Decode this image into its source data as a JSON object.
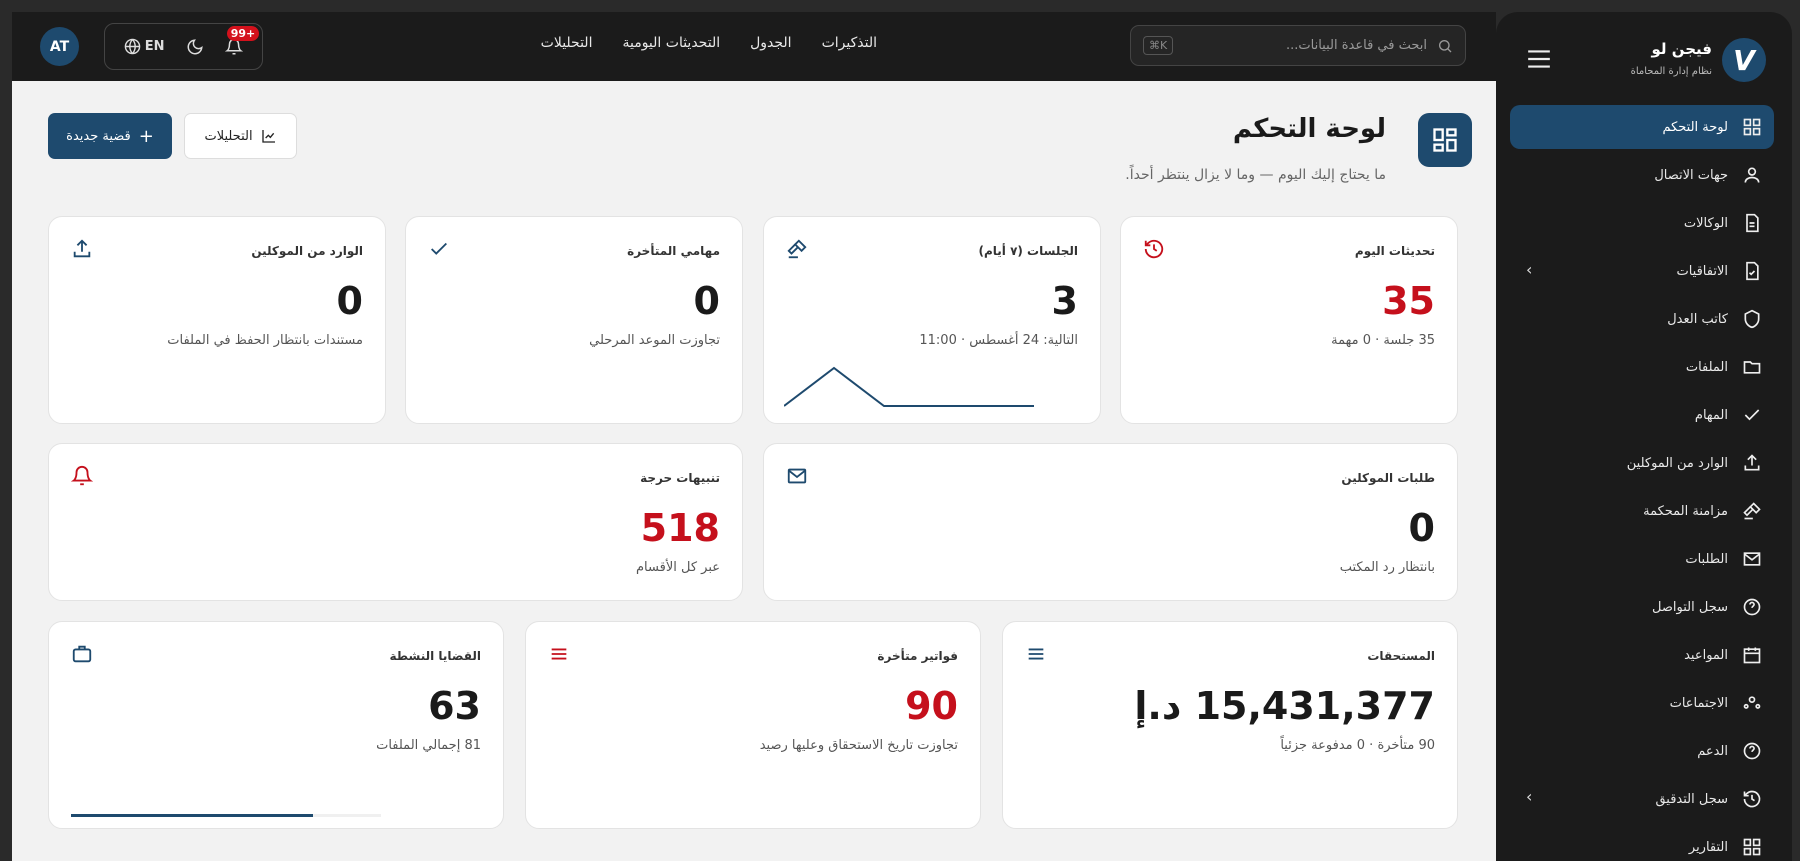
{
  "topbar": {
    "avatar": "AT",
    "lang": "EN",
    "notif_count": "99+",
    "nav": [
      "التذكيرات",
      "الجدول",
      "التحديثات اليومية",
      "التحليلات"
    ],
    "search_placeholder": "ابحث في قاعدة البيانات...",
    "search_kbd": "K⌘"
  },
  "header": {
    "title": "لوحة التحكم",
    "subtitle": "ما يحتاج إليك اليوم — وما لا يزال ينتظر أحداً.",
    "new_case": "قضية جديدة",
    "analytics": "التحليلات"
  },
  "cards": {
    "today": {
      "title": "تحديثات اليوم",
      "value": "35",
      "sub": "35 جلسة · 0 مهمة"
    },
    "sessions": {
      "title": "الجلسات (٧ أيام)",
      "value": "3",
      "sub": "التالية: 24 أغسطس · 11:00",
      "spark": [
        0,
        3,
        0,
        0,
        0,
        0
      ]
    },
    "overdue_tasks": {
      "title": "مهامي المتأخرة",
      "value": "0",
      "sub": "تجاوزت الموعد المرحلي"
    },
    "incoming": {
      "title": "الوارد من الموكلين",
      "value": "0",
      "sub": "مستندات بانتظار الحفظ في الملفات"
    },
    "client_requests": {
      "title": "طلبات الموكلين",
      "value": "0",
      "sub": "بانتظار رد المكتب"
    },
    "critical": {
      "title": "تنبيهات حرجة",
      "value": "518",
      "sub": "عبر كل الأقسام"
    },
    "receivables": {
      "title": "المستحقات",
      "value": "15,431,377 د.إ",
      "sub": "90 متأخرة · 0 مدفوعة جزئياً"
    },
    "overdue_invoices": {
      "title": "فواتير متأخرة",
      "value": "90",
      "sub": "تجاوزت تاريخ الاستحقاق وعليها رصيد"
    },
    "active_cases": {
      "title": "القضايا النشطة",
      "value": "63",
      "sub": "81 إجمالي الملفات",
      "progress": 0.78
    }
  },
  "sidebar": {
    "name": "فيجن لو",
    "tagline": "نظام إدارة المحاماة",
    "items": [
      "لوحة التحكم",
      "جهات الاتصال",
      "الوكالات",
      "الاتفاقيات",
      "كاتب العدل",
      "الملفات",
      "المهام",
      "الوارد من الموكلين",
      "مزامنة المحكمة",
      "الطلبات",
      "سجل التواصل",
      "المواعيد",
      "الاجتماعات",
      "الدعم",
      "سجل التدقيق",
      "التقارير"
    ]
  },
  "colors": {
    "accent": "#1e4a6e",
    "danger": "#c5101c"
  }
}
